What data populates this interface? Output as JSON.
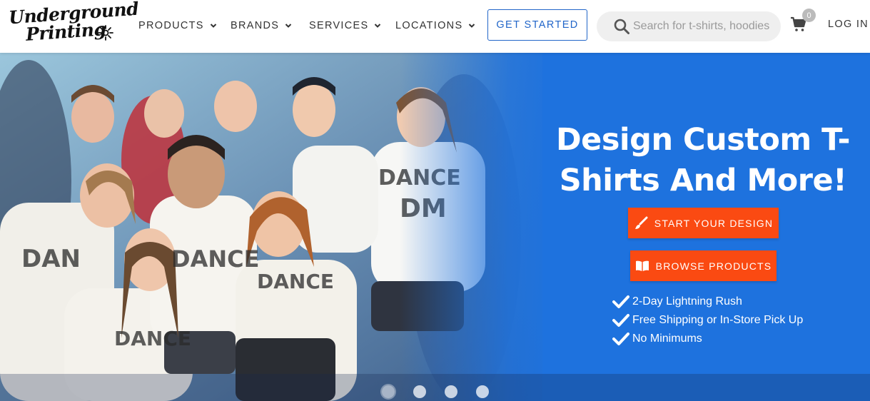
{
  "brand": {
    "logo_line1": "Underground",
    "logo_line2": "Printing"
  },
  "nav": {
    "items": [
      {
        "label": "PRODUCTS"
      },
      {
        "label": "BRANDS"
      },
      {
        "label": "SERVICES"
      },
      {
        "label": "LOCATIONS"
      }
    ],
    "get_started": "GET STARTED",
    "search_placeholder": "Search for t-shirts, hoodies",
    "cart_count": "0",
    "login": "LOG IN"
  },
  "hero": {
    "headline_line1": "Design Custom T-",
    "headline_line2": "Shirts And More!",
    "start_design": "START YOUR DESIGN",
    "browse_products": "BROWSE PRODUCTS",
    "features": [
      "2-Day Lightning Rush",
      "Free Shipping or In-Store Pick Up",
      "No Minimums"
    ],
    "slides_count": 4,
    "active_slide": 1
  },
  "colors": {
    "accent_blue": "#2266c9",
    "hero_blue": "#1e72de",
    "cta_orange": "#fa4a12"
  }
}
